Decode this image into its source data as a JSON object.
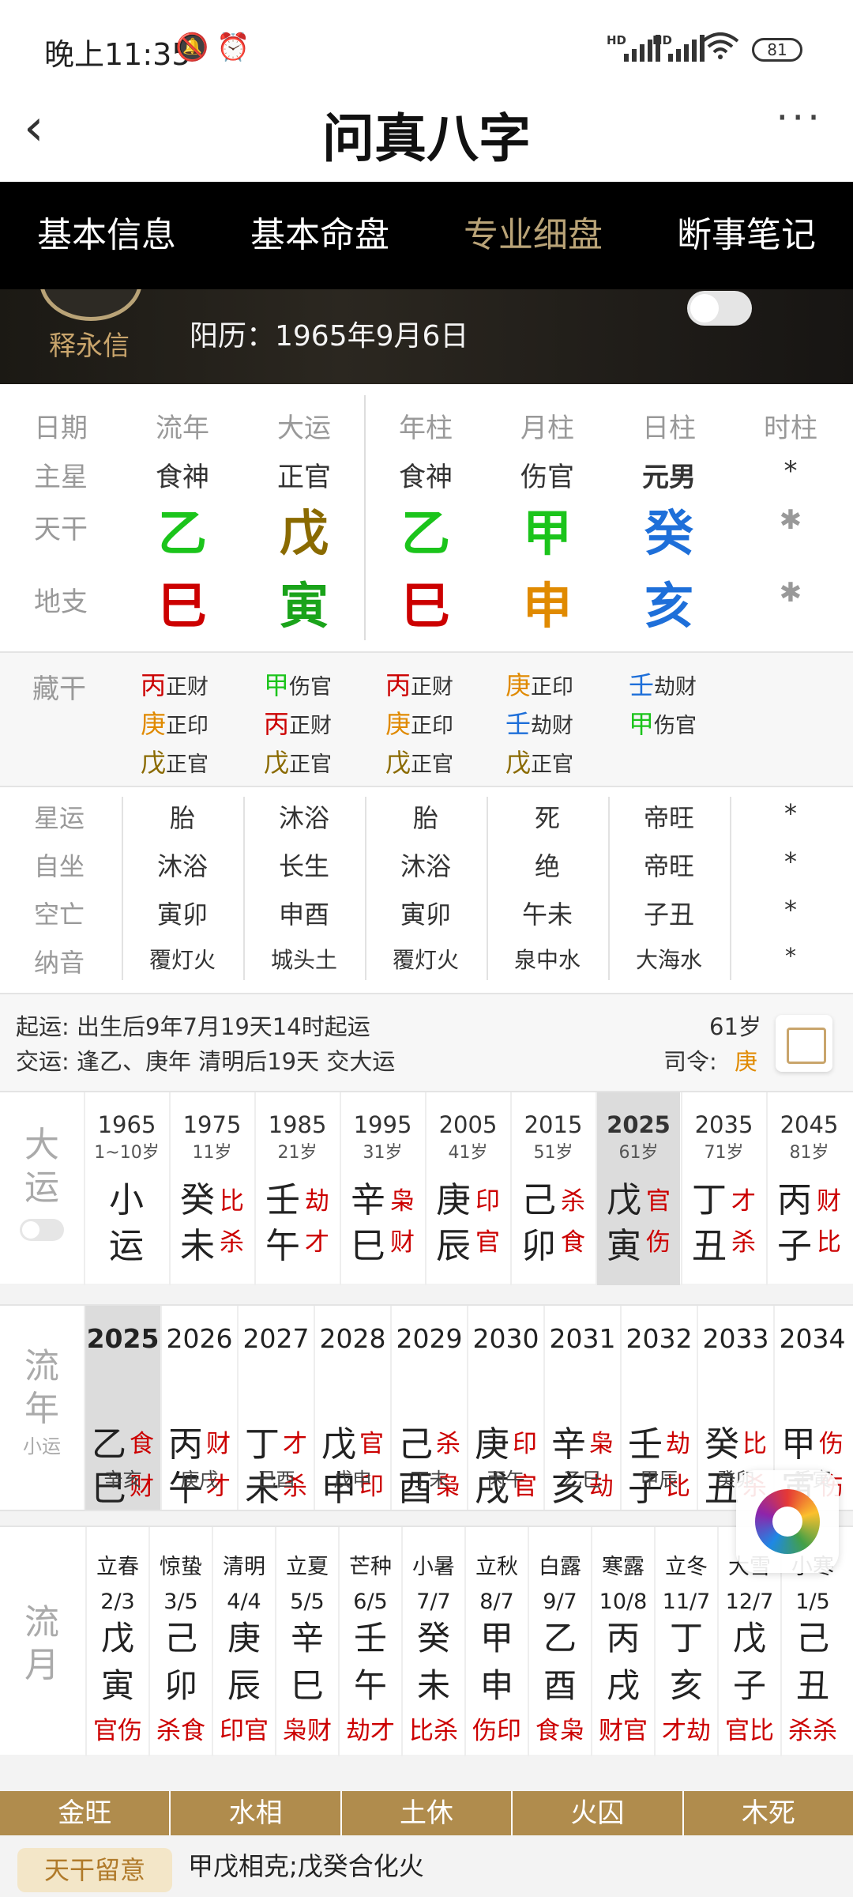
{
  "status_bar": {
    "time": "晚上11:35",
    "hd1": "HD",
    "hd2": "HD",
    "battery": "81"
  },
  "nav": {
    "back": "‹",
    "title": "问真八字",
    "more": "···"
  },
  "tabs": [
    "基本信息",
    "基本命盘",
    "专业细盘",
    "断事笔记"
  ],
  "profile": {
    "name": "释永信",
    "solar_date": "阳历：1965年9月6日"
  },
  "pillars": {
    "headers": [
      "日期",
      "流年",
      "大运",
      "年柱",
      "月柱",
      "日柱",
      "时柱"
    ],
    "row_labels": [
      "主星",
      "天干",
      "地支"
    ],
    "main_stars": [
      "食神",
      "正官",
      "食神",
      "伤官",
      "元男",
      "*"
    ],
    "stems": [
      {
        "t": "乙",
        "c": "#1bc41b"
      },
      {
        "t": "戊",
        "c": "#8a6a00"
      },
      {
        "t": "乙",
        "c": "#1bc41b"
      },
      {
        "t": "甲",
        "c": "#1bc41b"
      },
      {
        "t": "癸",
        "c": "#1e6fd9"
      },
      {
        "t": "✱",
        "c": "#999"
      }
    ],
    "branches": [
      {
        "t": "巳",
        "c": "#cc0000"
      },
      {
        "t": "寅",
        "c": "#1aa31a"
      },
      {
        "t": "巳",
        "c": "#cc0000"
      },
      {
        "t": "申",
        "c": "#e08a00"
      },
      {
        "t": "亥",
        "c": "#1e6fd9"
      },
      {
        "t": "✱",
        "c": "#999"
      }
    ]
  },
  "canggan": {
    "label": "藏干",
    "cols": [
      [
        {
          "s": "丙",
          "c": "#cc0000",
          "g": "正财"
        },
        {
          "s": "庚",
          "c": "#e08a00",
          "g": "正印"
        },
        {
          "s": "戊",
          "c": "#8a6a00",
          "g": "正官"
        }
      ],
      [
        {
          "s": "甲",
          "c": "#1bc41b",
          "g": "伤官"
        },
        {
          "s": "丙",
          "c": "#cc0000",
          "g": "正财"
        },
        {
          "s": "戊",
          "c": "#8a6a00",
          "g": "正官"
        }
      ],
      [
        {
          "s": "丙",
          "c": "#cc0000",
          "g": "正财"
        },
        {
          "s": "庚",
          "c": "#e08a00",
          "g": "正印"
        },
        {
          "s": "戊",
          "c": "#8a6a00",
          "g": "正官"
        }
      ],
      [
        {
          "s": "庚",
          "c": "#e08a00",
          "g": "正印"
        },
        {
          "s": "壬",
          "c": "#1e6fd9",
          "g": "劫财"
        },
        {
          "s": "戊",
          "c": "#8a6a00",
          "g": "正官"
        }
      ],
      [
        {
          "s": "壬",
          "c": "#1e6fd9",
          "g": "劫财"
        },
        {
          "s": "甲",
          "c": "#1bc41b",
          "g": "伤官"
        }
      ],
      []
    ]
  },
  "star_rows": [
    {
      "label": "星运",
      "vals": [
        "胎",
        "沐浴",
        "胎",
        "死",
        "帝旺",
        "*"
      ]
    },
    {
      "label": "自坐",
      "vals": [
        "沐浴",
        "长生",
        "沐浴",
        "绝",
        "帝旺",
        "*"
      ]
    },
    {
      "label": "空亡",
      "vals": [
        "寅卯",
        "申酉",
        "寅卯",
        "午未",
        "子丑",
        "*"
      ]
    },
    {
      "label": "纳音",
      "vals": [
        "覆灯火",
        "城头土",
        "覆灯火",
        "泉中水",
        "大海水",
        "*"
      ]
    }
  ],
  "qiyun": {
    "line1": "起运:   出生后9年7月19天14时起运",
    "line2": "交运:   逢乙、庚年 清明后19天 交大运",
    "age": "61岁",
    "siling_label": "司令:",
    "siling_value": "庚"
  },
  "dayun": {
    "label": [
      "大",
      "运"
    ],
    "cols": [
      {
        "yr": "1965",
        "age": "1~10岁",
        "c1": "小",
        "c2": "运",
        "g1": "",
        "g2": ""
      },
      {
        "yr": "1975",
        "age": "11岁",
        "c1": "癸",
        "c2": "未",
        "g1": "比",
        "g2": "杀"
      },
      {
        "yr": "1985",
        "age": "21岁",
        "c1": "壬",
        "c2": "午",
        "g1": "劫",
        "g2": "才"
      },
      {
        "yr": "1995",
        "age": "31岁",
        "c1": "辛",
        "c2": "巳",
        "g1": "枭",
        "g2": "财"
      },
      {
        "yr": "2005",
        "age": "41岁",
        "c1": "庚",
        "c2": "辰",
        "g1": "印",
        "g2": "官"
      },
      {
        "yr": "2015",
        "age": "51岁",
        "c1": "己",
        "c2": "卯",
        "g1": "杀",
        "g2": "食"
      },
      {
        "yr": "2025",
        "age": "61岁",
        "c1": "戊",
        "c2": "寅",
        "g1": "官",
        "g2": "伤"
      },
      {
        "yr": "2035",
        "age": "71岁",
        "c1": "丁",
        "c2": "丑",
        "g1": "才",
        "g2": "杀"
      },
      {
        "yr": "2045",
        "age": "81岁",
        "c1": "丙",
        "c2": "子",
        "g1": "财",
        "g2": "比"
      }
    ]
  },
  "liunian": {
    "label": [
      "流",
      "年"
    ],
    "sub": "小运",
    "cols": [
      {
        "yr": "2025",
        "c1": "乙",
        "c2": "巳",
        "g1": "食",
        "g2": "财",
        "foot": "辛亥"
      },
      {
        "yr": "2026",
        "c1": "丙",
        "c2": "午",
        "g1": "财",
        "g2": "才",
        "foot": "庚戌"
      },
      {
        "yr": "2027",
        "c1": "丁",
        "c2": "未",
        "g1": "才",
        "g2": "杀",
        "foot": "己酉"
      },
      {
        "yr": "2028",
        "c1": "戊",
        "c2": "申",
        "g1": "官",
        "g2": "印",
        "foot": "戊申"
      },
      {
        "yr": "2029",
        "c1": "己",
        "c2": "酉",
        "g1": "杀",
        "g2": "枭",
        "foot": "丁未"
      },
      {
        "yr": "2030",
        "c1": "庚",
        "c2": "戌",
        "g1": "印",
        "g2": "官",
        "foot": "丙午"
      },
      {
        "yr": "2031",
        "c1": "辛",
        "c2": "亥",
        "g1": "枭",
        "g2": "劫",
        "foot": "乙巳"
      },
      {
        "yr": "2032",
        "c1": "壬",
        "c2": "子",
        "g1": "劫",
        "g2": "比",
        "foot": "甲辰"
      },
      {
        "yr": "2033",
        "c1": "癸",
        "c2": "丑",
        "g1": "比",
        "g2": "杀",
        "foot": "癸卯"
      },
      {
        "yr": "2034",
        "c1": "甲",
        "c2": "寅",
        "g1": "伤",
        "g2": "伤",
        "foot": "壬寅"
      }
    ]
  },
  "liuyue": {
    "label": [
      "流",
      "月"
    ],
    "cols": [
      {
        "jq": "立春",
        "dt": "2/3",
        "g1": "戊",
        "g2": "寅",
        "ss": "官伤"
      },
      {
        "jq": "惊蛰",
        "dt": "3/5",
        "g1": "己",
        "g2": "卯",
        "ss": "杀食"
      },
      {
        "jq": "清明",
        "dt": "4/4",
        "g1": "庚",
        "g2": "辰",
        "ss": "印官"
      },
      {
        "jq": "立夏",
        "dt": "5/5",
        "g1": "辛",
        "g2": "巳",
        "ss": "枭财"
      },
      {
        "jq": "芒种",
        "dt": "6/5",
        "g1": "壬",
        "g2": "午",
        "ss": "劫才"
      },
      {
        "jq": "小暑",
        "dt": "7/7",
        "g1": "癸",
        "g2": "未",
        "ss": "比杀"
      },
      {
        "jq": "立秋",
        "dt": "8/7",
        "g1": "甲",
        "g2": "申",
        "ss": "伤印"
      },
      {
        "jq": "白露",
        "dt": "9/7",
        "g1": "乙",
        "g2": "酉",
        "ss": "食枭"
      },
      {
        "jq": "寒露",
        "dt": "10/8",
        "g1": "丙",
        "g2": "戌",
        "ss": "财官"
      },
      {
        "jq": "立冬",
        "dt": "11/7",
        "g1": "丁",
        "g2": "亥",
        "ss": "才劫"
      },
      {
        "jq": "大雪",
        "dt": "12/7",
        "g1": "戊",
        "g2": "子",
        "ss": "官比"
      },
      {
        "jq": "小寒",
        "dt": "1/5",
        "g1": "己",
        "g2": "丑",
        "ss": "杀杀"
      }
    ]
  },
  "wuxing": [
    "金旺",
    "水相",
    "土休",
    "火囚",
    "木死"
  ],
  "note": {
    "badge": "天干留意",
    "text": "甲戊相克;戊癸合化火"
  }
}
